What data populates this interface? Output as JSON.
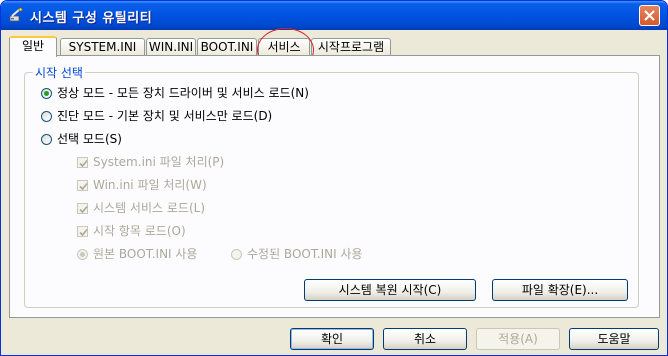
{
  "window": {
    "title": "시스템 구성 유틸리티",
    "title_color": "#0054e3"
  },
  "tabs": [
    {
      "label": "일반",
      "active": true
    },
    {
      "label": "SYSTEM.INI",
      "active": false
    },
    {
      "label": "WIN.INI",
      "active": false
    },
    {
      "label": "BOOT.INI",
      "active": false
    },
    {
      "label": "서비스",
      "active": false
    },
    {
      "label": "시작프로그램",
      "active": false
    }
  ],
  "startup": {
    "legend": "시작 선택",
    "normal": {
      "label": "정상 모드 - 모든 장치 드라이버 및 서비스 로드(N)",
      "checked": true
    },
    "diagnostic": {
      "label": "진단 모드 - 기본 장치 및 서비스만 로드(D)",
      "checked": false
    },
    "selective": {
      "label": "선택 모드(S)",
      "checked": false
    },
    "options": [
      {
        "label": "System.ini 파일 처리(P)",
        "checked": true
      },
      {
        "label": "Win.ini 파일 처리(W)",
        "checked": true
      },
      {
        "label": "시스템 서비스 로드(L)",
        "checked": true
      },
      {
        "label": "시작 항목 로드(O)",
        "checked": true
      }
    ],
    "boot_original": {
      "label": "원본 BOOT.INI 사용",
      "checked": true
    },
    "boot_modified": {
      "label": "수정된 BOOT.INI 사용",
      "checked": false
    }
  },
  "buttons": {
    "restore": "시스템 복원 시작(C)",
    "expand": "파일 확장(E)...",
    "ok": "확인",
    "cancel": "취소",
    "apply": "적용(A)",
    "help": "도움말"
  },
  "colors": {
    "accent_tab": "#ffc83c",
    "annotation": "#d8232a",
    "radio_dot": "#21a121"
  }
}
